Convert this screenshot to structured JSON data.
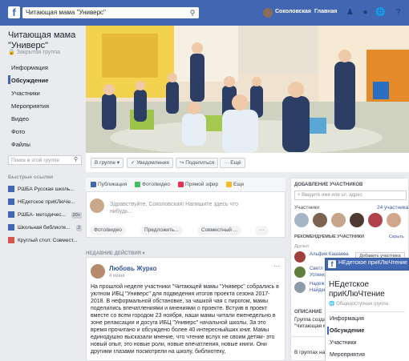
{
  "topbar": {
    "logo": "f",
    "search_value": "Читающая мама \"Универс\"",
    "user_name": "Соколовская",
    "home_label": "Главная",
    "icons": [
      "friends-icon",
      "messenger-icon",
      "notifications-icon",
      "help-icon"
    ]
  },
  "group": {
    "title": "Читающая мама \"Универс\"",
    "privacy": "Закрытая группа"
  },
  "nav": [
    "Информация",
    "Обсуждение",
    "Участники",
    "Мероприятия",
    "Видео",
    "Фото",
    "Файлы"
  ],
  "left_search_placeholder": "Поиск в этой группе",
  "quick_links": {
    "title": "Быстрые ссылки",
    "items": [
      {
        "label": "РШБА Русская школь...",
        "badge": ""
      },
      {
        "label": "НЕдетское приКЛюЧе...",
        "badge": ""
      },
      {
        "label": "РШБА- методичес...",
        "badge": "20+"
      },
      {
        "label": "Школьная библиоте...",
        "badge": "2"
      },
      {
        "label": "Круглый стол: Совмест...",
        "badge": ""
      }
    ]
  },
  "group_actions": {
    "in_group": "В группе ▾",
    "notifications": "✓ Уведомления",
    "share": "↪ Поделиться",
    "more": "··· Ещё"
  },
  "composer": {
    "tabs": [
      "Публикация",
      "Фото/видео",
      "Прямой эфир",
      "Еще"
    ],
    "placeholder": "Здравствуйте, Соколовская! Напишите здесь что нибудь...",
    "buttons": [
      "Фото/видео",
      "Предложить...",
      "Совместный ..."
    ],
    "more": "···"
  },
  "feed": {
    "section_label": "НЕДАВНИЕ ДЕЙСТВИЯ ▾",
    "post": {
      "author": "Любовь Журко",
      "date": "4 июня",
      "text": "На прошлой неделе участники \"Читающей мамы \"Универс\" собрались в уютном ИБЦ \"Универс\" для подведения итогов проекта сезона 2017-2018. В неформальной обстановке, за чашкой чая с пирогом, мамы поделились впечатлениями и мнениями о проекте. Встуив в проект вместе со всем городом 23 ноября, наши мамы читали еженедельно в зоне релаксации и досуга ИБЦ \"Универс\" начальной школы. За это время прочитано и обсуждено более 40 интересныйших книг. Мамы единодушно высказали мнение, что чтение вслух не своим детям- это новый опыт, это новые роли, новые впечатления, новые книги. Они другими глазами посмотрели на школу, библиотеку,"
    }
  },
  "right": {
    "add_members_title": "ДОБАВЛЕНИЕ УЧАСТНИКОВ",
    "add_member_placeholder": "+ Введите имя или эл. адрес",
    "members_label": "Участники",
    "members_count": "24 участника",
    "recommended_title": "РЕКОМЕНДУЕМЫЕ УЧАСТНИКИ",
    "hide": "Скрыть",
    "friends_label": "Друзья",
    "recommended": [
      "Альфия Кашаева",
      "Светл Успенк",
      "Надеж Найден"
    ],
    "add_button": "Добавить участника",
    "about_title": "ОПИСАНИЕ",
    "about_text": "Группа созда \"Читающая м",
    "groups_text": "В группах на"
  },
  "chat": {
    "title": "НЕдетское приКЛюЧтение",
    "group_name": "НЕдетское приКЛюЧтение",
    "privacy": "Общедоступная группа",
    "nav": [
      "Информация",
      "Обсуждение",
      "Участники",
      "Мероприятия"
    ]
  }
}
